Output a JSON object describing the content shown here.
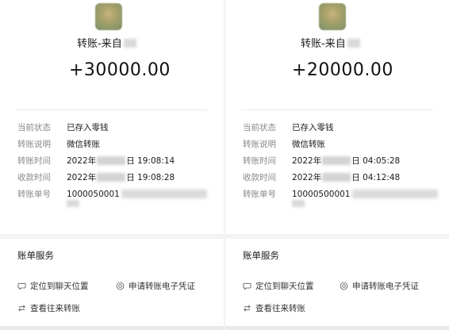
{
  "receipts": [
    {
      "from_label": "转账-来自",
      "amount": "+30000.00",
      "rows": [
        {
          "key": "当前状态",
          "value": "已存入零钱"
        },
        {
          "key": "转账说明",
          "value": "微信转账"
        },
        {
          "key": "转账时间",
          "value_prefix": "2022年",
          "value_suffix": "日 19:08:14"
        },
        {
          "key": "收款时间",
          "value_prefix": "2022年",
          "value_suffix": "日 19:08:28"
        },
        {
          "key": "转账单号",
          "value": "1000050001"
        }
      ],
      "services_title": "账单服务",
      "services": {
        "chat": "定位到聊天位置",
        "cert": "申请转账电子凭证",
        "history": "查看往来转账"
      }
    },
    {
      "from_label": "转账-来自",
      "amount": "+20000.00",
      "rows": [
        {
          "key": "当前状态",
          "value": "已存入零钱"
        },
        {
          "key": "转账说明",
          "value": "微信转账"
        },
        {
          "key": "转账时间",
          "value_prefix": "2022年",
          "value_suffix": "日 04:05:28"
        },
        {
          "key": "收款时间",
          "value_prefix": "2022年",
          "value_suffix": "日 04:12:48"
        },
        {
          "key": "转账单号",
          "value": "10000500001"
        }
      ],
      "services_title": "账单服务",
      "services": {
        "chat": "定位到聊天位置",
        "cert": "申请转账电子凭证",
        "history": "查看往来转账"
      }
    }
  ],
  "icons": {
    "chat": "chat-bubble-icon",
    "cert": "certificate-icon",
    "history": "transfer-arrows-icon"
  },
  "colors": {
    "label_gray": "#888888",
    "background": "#f2f2f2",
    "card": "#ffffff"
  }
}
